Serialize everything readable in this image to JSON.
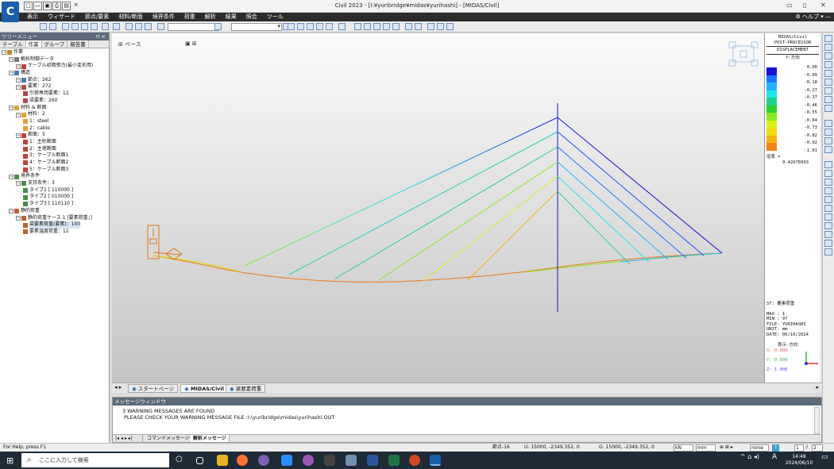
{
  "window": {
    "title": "Civil 2023 - [I:¥yuribridge¥midas¥yurihashi] - [MIDAS/Civil]",
    "app_logo": "C",
    "quick_access_icons": [
      "new-icon",
      "open-icon",
      "save-icon",
      "print-icon",
      "preview-icon",
      "close-icon"
    ]
  },
  "menu": {
    "items": [
      "表示",
      "ウィザード",
      "節点/要素",
      "材料/断面",
      "境界条件",
      "荷重",
      "解析",
      "結果",
      "照合",
      "ツール"
    ],
    "help_label": "ヘルプ"
  },
  "tree_panel": {
    "header": "ツリーメニュー",
    "tabs": [
      "テーブル",
      "作業",
      "グループ",
      "報告書"
    ],
    "active_tab": "作業",
    "nodes": [
      {
        "label": "作業",
        "level": 0,
        "icon": "folder-icon"
      },
      {
        "label": "解析制御データ",
        "level": 1,
        "icon": "gear-icon"
      },
      {
        "label": "ケーブル初期張力(最小変形用)",
        "level": 2,
        "icon": "cable-icon"
      },
      {
        "label": "構造",
        "level": 1,
        "icon": "structure-icon"
      },
      {
        "label": "節点：262",
        "level": 2,
        "icon": "node-icon"
      },
      {
        "label": "要素：272",
        "level": 2,
        "icon": "element-icon"
      },
      {
        "label": "引張専用要素：12",
        "level": 3,
        "icon": "element-icon"
      },
      {
        "label": "梁要素：260",
        "level": 3,
        "icon": "element-icon"
      },
      {
        "label": "材料 & 断面",
        "level": 1,
        "icon": "material-icon"
      },
      {
        "label": "材料：2",
        "level": 2,
        "icon": "material-icon"
      },
      {
        "label": "1：steel",
        "level": 3,
        "icon": "material-icon"
      },
      {
        "label": "2：cable",
        "level": 3,
        "icon": "material-icon"
      },
      {
        "label": "断面：5",
        "level": 2,
        "icon": "section-icon"
      },
      {
        "label": "1：主桁断面",
        "level": 3,
        "icon": "section-icon"
      },
      {
        "label": "2：主塔断面",
        "level": 3,
        "icon": "section-icon"
      },
      {
        "label": "3：ケーブル断面1",
        "level": 3,
        "icon": "section-icon"
      },
      {
        "label": "4：ケーブル断面2",
        "level": 3,
        "icon": "section-icon"
      },
      {
        "label": "5：ケーブル断面3",
        "level": 3,
        "icon": "section-icon"
      },
      {
        "label": "境界条件",
        "level": 1,
        "icon": "support-icon"
      },
      {
        "label": "支持条件：3",
        "level": 2,
        "icon": "support-icon"
      },
      {
        "label": "タイプ1 [ 110000 ]",
        "level": 3,
        "icon": "support-icon"
      },
      {
        "label": "タイプ2 [ 010000 ]",
        "level": 3,
        "icon": "support-icon"
      },
      {
        "label": "タイプ3 [ 110110 ]",
        "level": 3,
        "icon": "support-icon"
      },
      {
        "label": "静的荷重",
        "level": 1,
        "icon": "load-icon"
      },
      {
        "label": "静的荷重ケース 1 [要素荷重；]",
        "level": 2,
        "icon": "load-icon"
      },
      {
        "label": "梁要素荷重(要素)：100",
        "level": 3,
        "icon": "load-icon",
        "selected": true
      },
      {
        "label": "要素温度荷重：12",
        "level": 3,
        "icon": "load-icon"
      }
    ]
  },
  "toolbar": {
    "combo_1": "",
    "combo_2": ""
  },
  "viewport": {
    "base_label": "ベース",
    "background_top": "#fbfbfb",
    "background_bottom": "#c4c4c4"
  },
  "legend": {
    "header_1": "MIDAS/Civil",
    "header_2": "POST-PROCESSOR",
    "header_3": "DISPLACEMENT",
    "component": "Y-方向",
    "values": [
      "0.00",
      "-0.09",
      "-0.18",
      "-0.27",
      "-0.37",
      "-0.46",
      "-0.55",
      "-0.64",
      "-0.73",
      "-0.82",
      "-0.92",
      "-1.01"
    ],
    "colors": [
      "#1414d2",
      "#1e78ff",
      "#22b4ff",
      "#22e6e6",
      "#22d28c",
      "#2ad22a",
      "#8ce61e",
      "#dcf01e",
      "#f0dc14",
      "#f0b414",
      "#f08214",
      "#e64614"
    ],
    "scale_label": "倍率 =",
    "scale_value": "9.4267E003",
    "info": [
      "ST: 要素荷重",
      "MAX : 1",
      "MIN : 97",
      "FILE: YURIHASHI",
      "UNIT: mm",
      "DATE: 06/10/2024"
    ],
    "direction_label": "表示-方向",
    "axes": [
      {
        "text": "X: 0.000",
        "color": "#e06060"
      },
      {
        "text": "Y: 0.000",
        "color": "#40b040"
      },
      {
        "text": "Z: 1.000",
        "color": "#5050ff"
      }
    ]
  },
  "doc_tabs": {
    "tabs": [
      "スタートページ",
      "MIDAS/Civil",
      "梁要素荷重"
    ],
    "active": "MIDAS/Civil"
  },
  "message_window": {
    "title": "メッセージウィンドウ",
    "lines": [
      "3 WARNING MESSAGES ARE FOUND",
      "PLEASE CHECK YOUR WARNING MESSAGE FILE :I:\\yuribridge\\midas\\yurihashi.OUT"
    ],
    "tabs": [
      "コマンドメッセージ",
      "解析メッセージ"
    ],
    "active_tab": "解析メッセージ"
  },
  "status": {
    "help": "For Help, press F1",
    "node": "節点-16",
    "u_coord": "U: 15000, -2349.352, 0",
    "g_coord": "G: 15000, -2349.352, 0",
    "force_unit": "kN",
    "length_unit": "mm",
    "none_label": "none",
    "page_current": "1",
    "page_total": "2"
  },
  "taskbar": {
    "search_placeholder": "ここに入力して検索",
    "time": "14:48",
    "date": "2024/06/10",
    "ime": "A"
  }
}
